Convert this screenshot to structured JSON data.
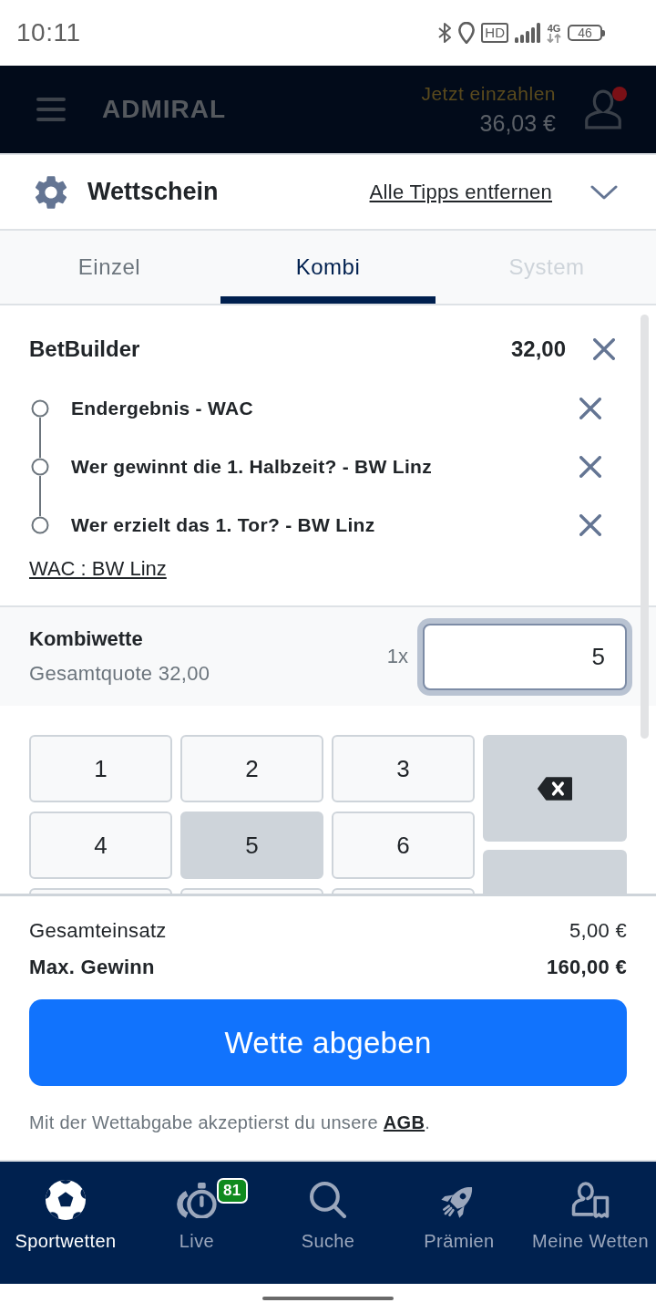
{
  "status_bar": {
    "time": "10:11",
    "hd_label": "HD",
    "network_label": "4G",
    "battery_label": "46"
  },
  "header": {
    "logo": "ADMIRAL",
    "deposit_label": "Jetzt einzahlen",
    "balance": "36,03 €",
    "notification_dot": true
  },
  "betslip": {
    "title": "Wettschein",
    "clear_link": "Alle Tipps entfernen",
    "tabs": [
      {
        "label": "Einzel",
        "selected": false,
        "disabled": false
      },
      {
        "label": "Kombi",
        "selected": true,
        "disabled": false
      },
      {
        "label": "System",
        "selected": false,
        "disabled": true
      }
    ],
    "bet_builder": {
      "title": "BetBuilder",
      "odds": "32,00",
      "selections": [
        {
          "label": "Endergebnis - WAC"
        },
        {
          "label": "Wer gewinnt die 1. Halbzeit? - BW Linz"
        },
        {
          "label": "Wer erzielt das 1. Tor? - BW Linz"
        }
      ],
      "match_link": "WAC : BW Linz"
    },
    "combo": {
      "title": "Kombiwette",
      "total_odds": "Gesamtquote 32,00",
      "multiplier": "1x",
      "stake": "5",
      "focused": true
    },
    "keypad": {
      "keys": [
        {
          "kind": "digit",
          "label": "1",
          "pressed": false
        },
        {
          "kind": "digit",
          "label": "2",
          "pressed": false
        },
        {
          "kind": "digit",
          "label": "3",
          "pressed": false
        },
        {
          "kind": "digit",
          "label": "4",
          "pressed": false
        },
        {
          "kind": "digit",
          "label": "5",
          "pressed": true
        },
        {
          "kind": "digit",
          "label": "6",
          "pressed": false
        },
        {
          "kind": "digit",
          "pressed": false
        },
        {
          "kind": "digit",
          "pressed": false
        },
        {
          "kind": "digit",
          "pressed": false
        }
      ],
      "side_keys": [
        {
          "kind": "backspace"
        },
        {
          "kind": "action"
        }
      ]
    },
    "summary": [
      {
        "label": "Gesamteinsatz",
        "value": "5,00 €",
        "emphasis": false
      },
      {
        "label": "Max. Gewinn",
        "value": "160,00 €",
        "emphasis": true
      }
    ],
    "submit_label": "Wette abgeben",
    "terms": {
      "text": "Mit der Wettabgabe akzeptierst du unsere",
      "link": "AGB",
      "suffix": "."
    }
  },
  "bottom_nav": [
    {
      "label": "Sportwetten",
      "selected": true
    },
    {
      "label": "Live",
      "selected": false,
      "badge": "81"
    },
    {
      "label": "Suche",
      "selected": false
    },
    {
      "label": "Prämien",
      "selected": false
    },
    {
      "label": "Meine Wetten",
      "selected": false
    }
  ]
}
